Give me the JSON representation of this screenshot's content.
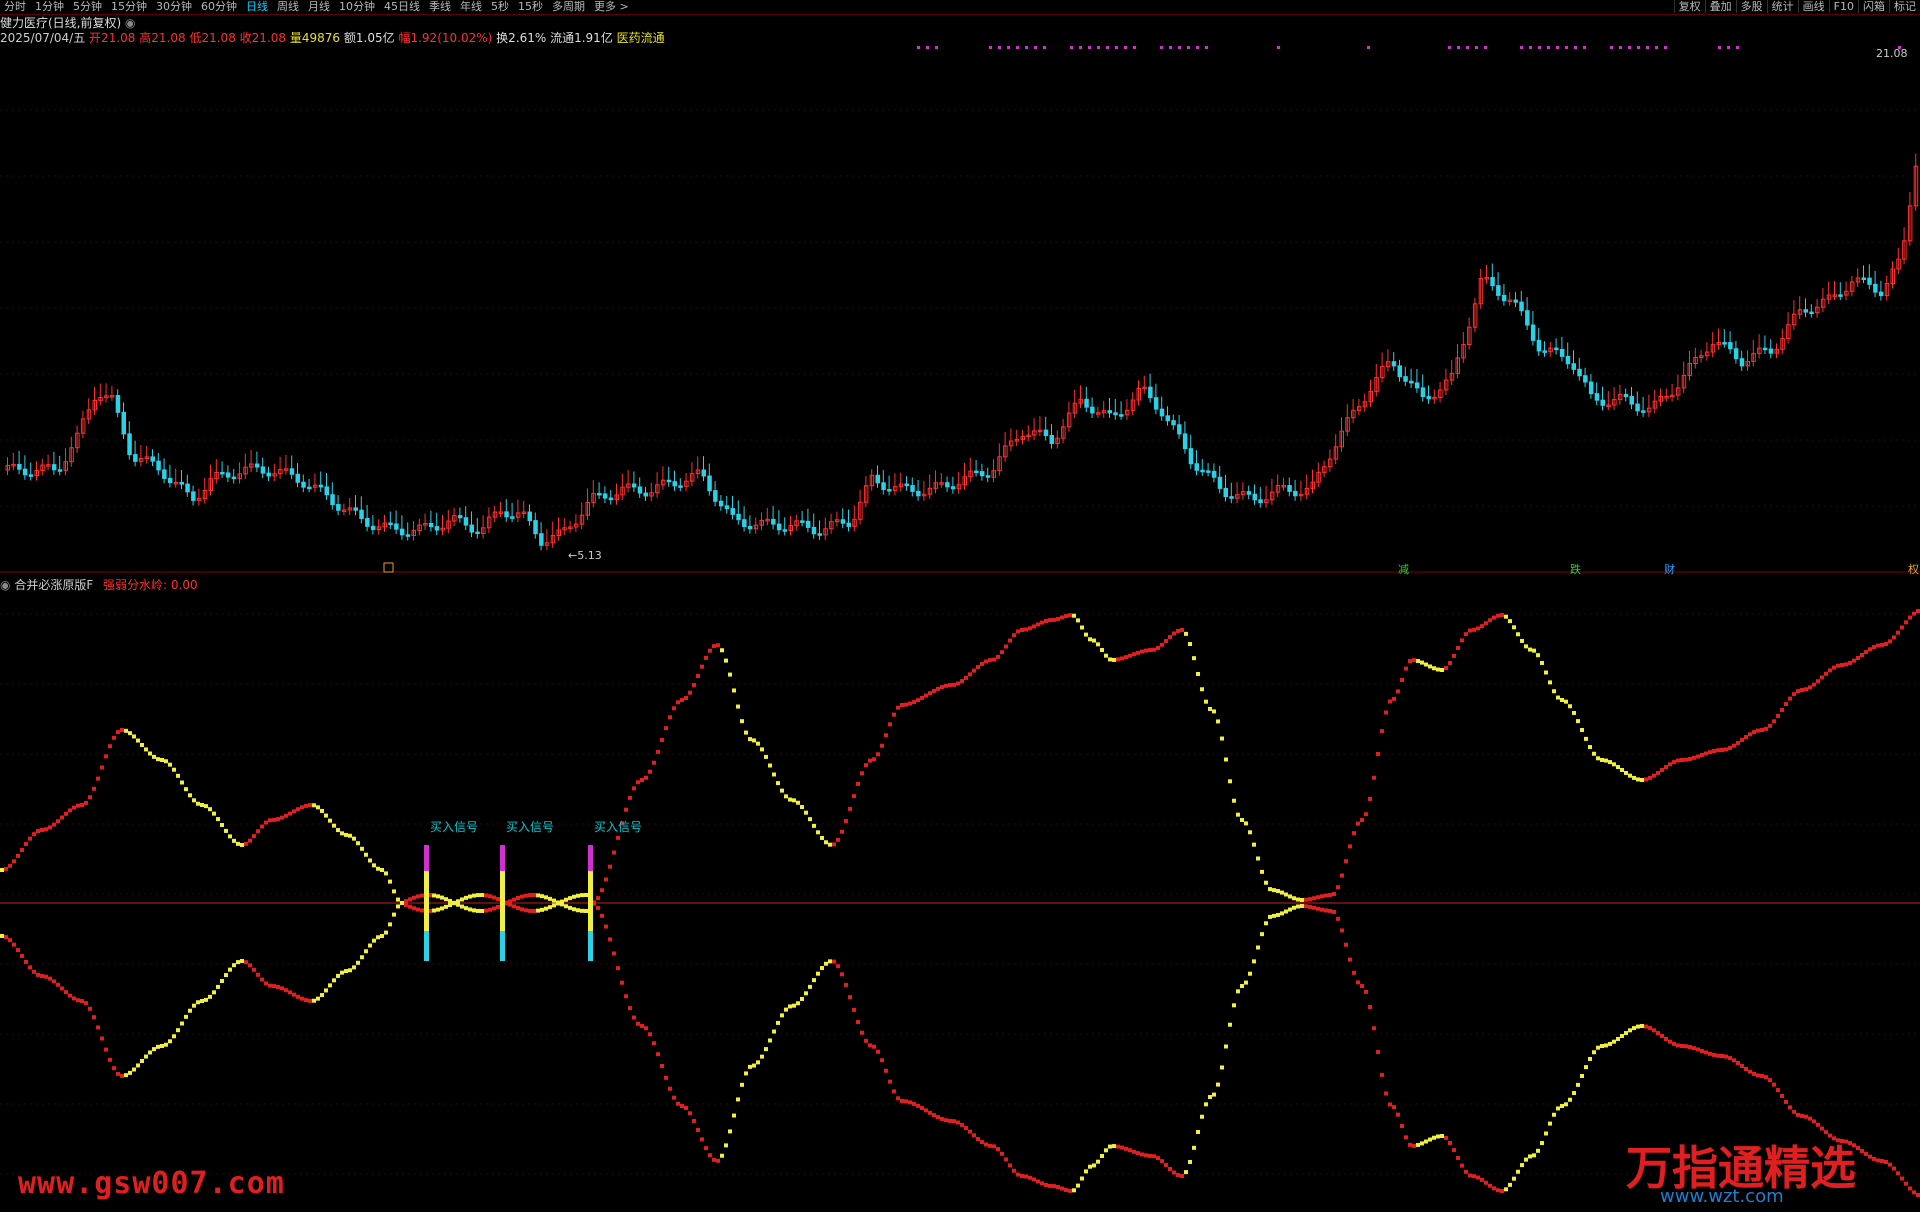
{
  "toolbar": {
    "periods": [
      "分时",
      "1分钟",
      "5分钟",
      "15分钟",
      "30分钟",
      "60分钟",
      "日线",
      "周线",
      "月线",
      "10分钟",
      "45日线",
      "季线",
      "年线",
      "5秒",
      "15秒",
      "多周期",
      "更多 >"
    ],
    "active_period": "日线",
    "right_items": [
      "复权",
      "叠加",
      "多股",
      "统计",
      "画线",
      "F10",
      "闪箱",
      "标记"
    ]
  },
  "stock": {
    "title": "健力医疗(日线,前复权)",
    "date": "2025/07/04/五",
    "open_label": "开",
    "open": "21.08",
    "high_label": "高",
    "high": "21.08",
    "low_label": "低",
    "low": "21.08",
    "close_label": "收",
    "close": "21.08",
    "volume_label": "量",
    "volume": "49876",
    "amount": "额1.05亿",
    "change_label": "幅",
    "change": "1.92(10.02%)",
    "turnover": "换2.61%",
    "float": "流通1.91亿",
    "sector": "医药流通"
  },
  "price_axis": {
    "top_price": "21.08",
    "low_price": "5.13"
  },
  "markers": [
    "减",
    "跌",
    "财",
    "权"
  ],
  "indicator": {
    "name": "合并必涨原版F",
    "value_label": "强弱分水岭: 0.00"
  },
  "signals": [
    "买入信号",
    "买入信号",
    "买入信号"
  ],
  "colors": {
    "up": "#ff3030",
    "down": "#2ad2e8",
    "line_red": "#e02020",
    "line_yellow": "#f0f040",
    "magenta": "#d030d0"
  },
  "watermark": {
    "left": "www.gsw007.com",
    "right": "万指通精选",
    "url": "www.wzt.com"
  }
}
